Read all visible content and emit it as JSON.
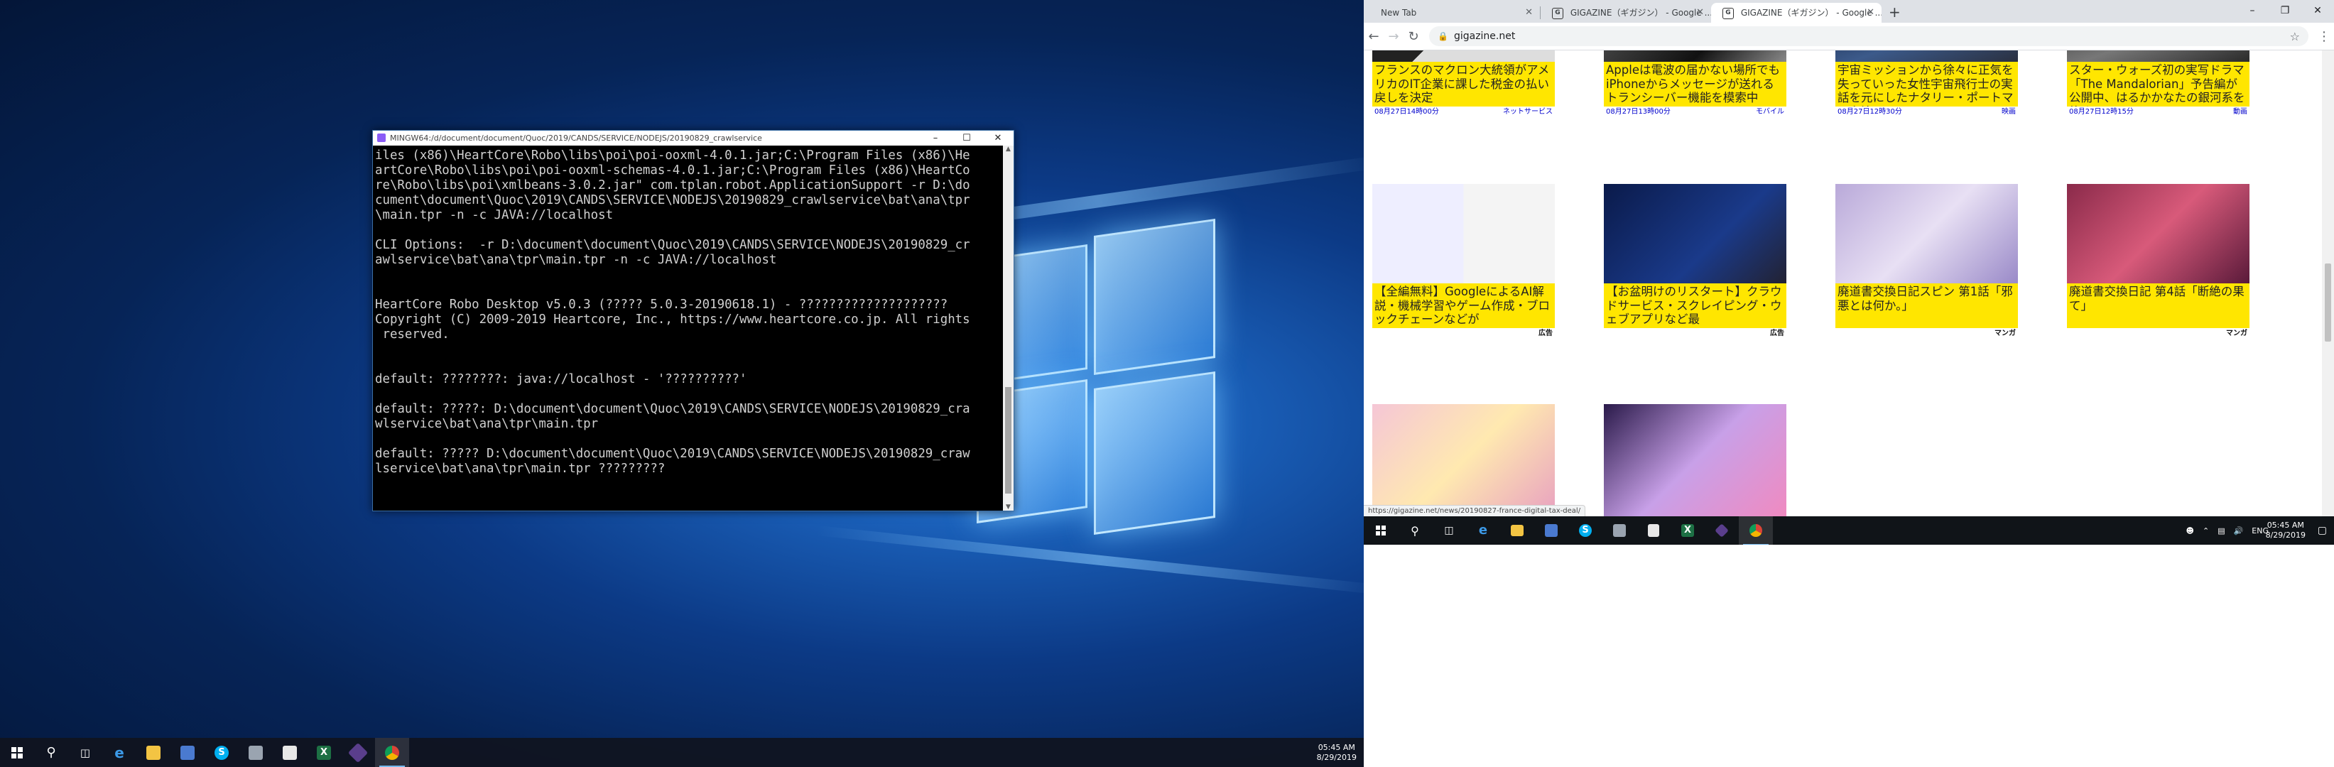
{
  "terminal": {
    "title": "MINGW64:/d/document/document/Quoc/2019/CANDS/SERVICE/NODEJS/20190829_crawlservice",
    "lines": [
      "iles (x86)\\HeartCore\\Robo\\libs\\poi\\poi-ooxml-4.0.1.jar;C:\\Program Files (x86)\\He",
      "artCore\\Robo\\libs\\poi\\poi-ooxml-schemas-4.0.1.jar;C:\\Program Files (x86)\\HeartCo",
      "re\\Robo\\libs\\poi\\xmlbeans-3.0.2.jar\" com.tplan.robot.ApplicationSupport -r D:\\do",
      "cument\\document\\Quoc\\2019\\CANDS\\SERVICE\\NODEJS\\20190829_crawlservice\\bat\\ana\\tpr",
      "\\main.tpr -n -c JAVA://localhost",
      "",
      "CLI Options:  -r D:\\document\\document\\Quoc\\2019\\CANDS\\SERVICE\\NODEJS\\20190829_cr",
      "awlservice\\bat\\ana\\tpr\\main.tpr -n -c JAVA://localhost",
      "",
      "",
      "HeartCore Robo Desktop v5.0.3 (????? 5.0.3-20190618.1) - ????????????????????",
      "Copyright (C) 2009-2019 Heartcore, Inc., https://www.heartcore.co.jp. All rights",
      " reserved.",
      "",
      "",
      "default: ????????: java://localhost - '??????????'",
      "",
      "default: ?????: D:\\document\\document\\Quoc\\2019\\CANDS\\SERVICE\\NODEJS\\20190829_cra",
      "wlservice\\bat\\ana\\tpr\\main.tpr",
      "",
      "default: ????? D:\\document\\document\\Quoc\\2019\\CANDS\\SERVICE\\NODEJS\\20190829_craw",
      "lservice\\bat\\ana\\tpr\\main.tpr ?????????"
    ]
  },
  "taskbar1": {
    "time": "05:45 AM",
    "date": "8/29/2019"
  },
  "browser": {
    "tabs": [
      {
        "label": "New Tab"
      },
      {
        "label": "GIGAZINE（ギガジン） - Google ..."
      },
      {
        "label": "GIGAZINE（ギガジン） - Google ..."
      }
    ],
    "url": "gigazine.net",
    "status_url": "https://gigazine.net/news/20190827-france-digital-tax-deal/",
    "cards": [
      {
        "caption": "フランスのマクロン大統領がアメリカのIT企業に課した税金の払い戻しを決定",
        "date": "08月27日14時00分",
        "category": "ネットサービス"
      },
      {
        "caption": "Appleは電波の届かない場所でもiPhoneからメッセージが送れるトランシーバー機能を模索中",
        "date": "08月27日13時00分",
        "category": "モバイル"
      },
      {
        "caption": "宇宙ミッションから徐々に正気を失っていった女性宇宙飛行士の実話を元にしたナタリー・ポートマン主演",
        "date": "08月27日12時30分",
        "category": "映画"
      },
      {
        "caption": "スター・ウォーズ初の実写ドラマ「The Mandalorian」予告編が公開中、はるかかなたの銀河系を旅する",
        "date": "08月27日12時15分",
        "category": "動画"
      },
      {
        "caption": "【全編無料】GoogleによるAI解説・機械学習やゲーム作成・ブロックチェーンなどが",
        "date": "",
        "category": "広告"
      },
      {
        "caption": "【お盆明けのリスタート】クラウドサービス・スクレイピング・ウェブアプリなど最",
        "date": "",
        "category": "広告"
      },
      {
        "caption": "廃道書交換日記スピン 第1話「邪悪とは何か。」",
        "date": "",
        "category": "マンガ"
      },
      {
        "caption": "廃道書交換日記 第4話「断絶の果て」",
        "date": "",
        "category": "マンガ"
      }
    ]
  },
  "taskbar2": {
    "lang": "ENG",
    "time": "05:45 AM",
    "date": "8/29/2019"
  }
}
